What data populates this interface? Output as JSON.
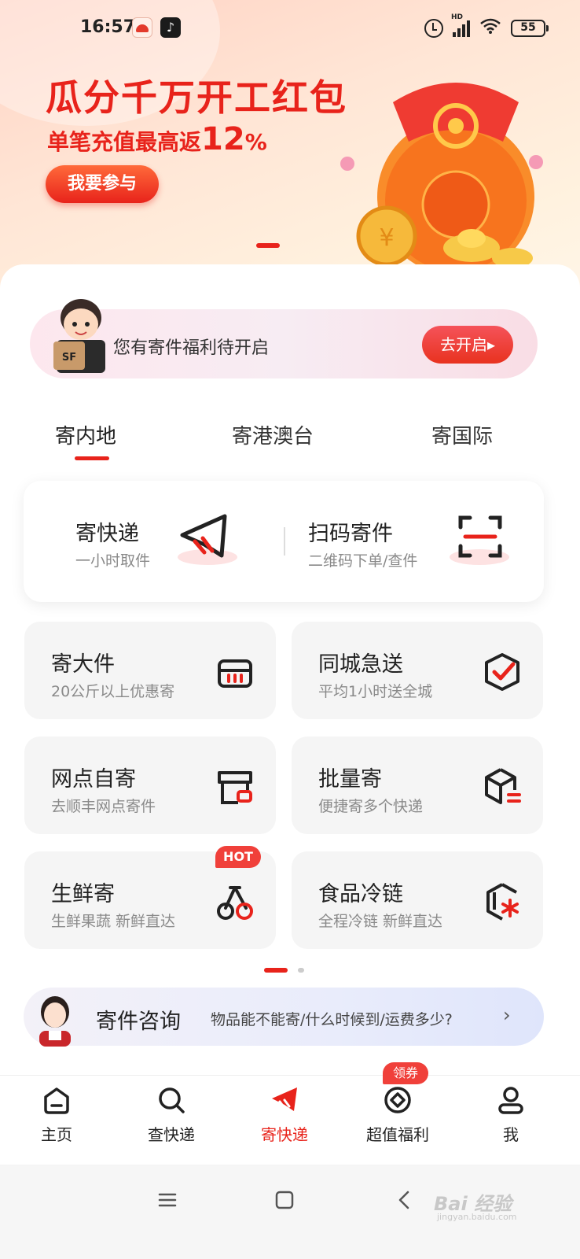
{
  "status_bar": {
    "time": "16:57",
    "battery": "55",
    "signal_label": "HD",
    "wifi_icon": "wifi-icon"
  },
  "banner": {
    "title": "瓜分千万开工红包",
    "subtitle_prefix": "单笔充值最高返",
    "subtitle_value": "12",
    "subtitle_unit": "%",
    "cta": "我要参与"
  },
  "promo": {
    "text": "您有寄件福利待开启",
    "button": "去开启",
    "chevron": "▸"
  },
  "tabs": [
    {
      "label": "寄内地",
      "active": true
    },
    {
      "label": "寄港澳台",
      "active": false
    },
    {
      "label": "寄国际",
      "active": false
    }
  ],
  "top_actions": [
    {
      "title": "寄快递",
      "sub": "一小时取件",
      "icon": "paper-plane-icon"
    },
    {
      "title": "扫码寄件",
      "sub": "二维码下单/查件",
      "icon": "scan-icon"
    }
  ],
  "services": [
    {
      "title": "寄大件",
      "sub": "20公斤以上优惠寄",
      "icon": "box-icon"
    },
    {
      "title": "同城急送",
      "sub": "平均1小时送全城",
      "icon": "shield-check-icon"
    },
    {
      "title": "网点自寄",
      "sub": "去顺丰网点寄件",
      "icon": "store-icon"
    },
    {
      "title": "批量寄",
      "sub": "便捷寄多个快递",
      "icon": "cube-list-icon"
    },
    {
      "title": "生鲜寄",
      "sub": "生鲜果蔬 新鲜直达",
      "icon": "cherry-icon",
      "badge": "HOT"
    },
    {
      "title": "食品冷链",
      "sub": "全程冷链 新鲜直达",
      "icon": "snowflake-icon"
    }
  ],
  "consult": {
    "title": "寄件咨询",
    "question": "物品能不能寄/什么时候到/运费多少?",
    "chevron": "›"
  },
  "nav": [
    {
      "label": "主页",
      "icon": "home-icon",
      "active": false
    },
    {
      "label": "查快递",
      "icon": "search-icon",
      "active": false
    },
    {
      "label": "寄快递",
      "icon": "send-icon",
      "active": true
    },
    {
      "label": "超值福利",
      "icon": "target-icon",
      "active": false,
      "badge": "领券"
    },
    {
      "label": "我",
      "icon": "user-icon",
      "active": false
    }
  ],
  "system_nav": [
    "menu-icon",
    "home-square-icon",
    "back-icon"
  ],
  "watermark": {
    "text": "Bai 经验",
    "sub": "jingyan.baidu.com"
  },
  "colors": {
    "accent": "#e8231b",
    "tile_bg": "#f5f5f5",
    "muted": "#8a8a8a"
  }
}
